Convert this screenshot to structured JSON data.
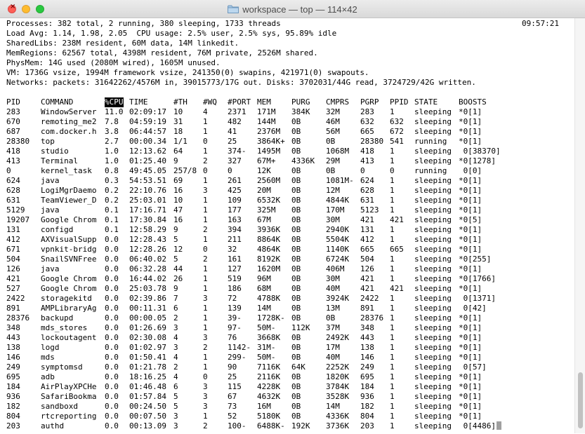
{
  "window": {
    "title": "workspace — top — 114×42",
    "icon": "folder-icon"
  },
  "summary": {
    "processes": "Processes: 382 total, 2 running, 380 sleeping, 1733 threads",
    "clock": "09:57:21",
    "load": "Load Avg: 1.14, 1.98, 2.05  CPU usage: 2.5% user, 2.5% sys, 95.89% idle",
    "sharedlibs": "SharedLibs: 238M resident, 60M data, 14M linkedit.",
    "memregions": "MemRegions: 62567 total, 4398M resident, 76M private, 2526M shared.",
    "physmem": "PhysMem: 14G used (2080M wired), 1605M unused.",
    "vm": "VM: 1736G vsize, 1994M framework vsize, 241350(0) swapins, 421971(0) swapouts.",
    "networks": "Networks: packets: 31642262/4576M in, 39015773/17G out. Disks: 3702031/44G read, 3724729/42G written."
  },
  "table": {
    "headers": [
      "PID",
      "COMMAND",
      "%CPU",
      "TIME",
      "#TH",
      "#WQ",
      "#PORT",
      "MEM",
      "PURG",
      "CMPRS",
      "PGRP",
      "PPID",
      "STATE",
      "BOOSTS"
    ],
    "sorted_column": "%CPU",
    "rows": [
      [
        "283",
        "WindowServer",
        "11.0",
        "02:09:17",
        "10",
        "4",
        "2371",
        "171M",
        "384K",
        "32M",
        "283",
        "1",
        "sleeping",
        "*0[1]"
      ],
      [
        "670",
        "remoting_me2",
        "7.8",
        "04:59:19",
        "31",
        "1",
        "482",
        "144M",
        "0B",
        "46M",
        "632",
        "632",
        "sleeping",
        "*0[1]"
      ],
      [
        "687",
        "com.docker.h",
        "3.8",
        "06:44:57",
        "18",
        "1",
        "41",
        "2376M",
        "0B",
        "56M",
        "665",
        "672",
        "sleeping",
        "*0[1]"
      ],
      [
        "28380",
        "top",
        "2.7",
        "00:00.34",
        "1/1",
        "0",
        "25",
        "3864K+",
        "0B",
        "0B",
        "28380",
        "541",
        "running",
        "*0[1]"
      ],
      [
        "418",
        "studio",
        "1.0",
        "12:13.62",
        "64",
        "1",
        "374-",
        "1495M",
        "0B",
        "1068M",
        "418",
        "1",
        "sleeping",
        " 0[38370]"
      ],
      [
        "413",
        "Terminal",
        "1.0",
        "01:25.40",
        "9",
        "2",
        "327",
        "67M+",
        "4336K",
        "29M",
        "413",
        "1",
        "sleeping",
        "*0[1278]"
      ],
      [
        "0",
        "kernel_task",
        "0.8",
        "49:45.05",
        "257/8",
        "0",
        "0",
        "12K",
        "0B",
        "0B",
        "0",
        "0",
        "running",
        " 0[0]"
      ],
      [
        "624",
        "java",
        "0.3",
        "54:53.51",
        "69",
        "1",
        "261",
        "2560M",
        "0B",
        "1081M-",
        "624",
        "1",
        "sleeping",
        "*0[1]"
      ],
      [
        "628",
        "LogiMgrDaemo",
        "0.2",
        "22:10.76",
        "16",
        "3",
        "425",
        "20M",
        "0B",
        "12M",
        "628",
        "1",
        "sleeping",
        "*0[1]"
      ],
      [
        "631",
        "TeamViewer_D",
        "0.2",
        "25:03.01",
        "10",
        "1",
        "109",
        "6532K",
        "0B",
        "4844K",
        "631",
        "1",
        "sleeping",
        "*0[1]"
      ],
      [
        "5129",
        "java",
        "0.1",
        "17:16.71",
        "47",
        "1",
        "177",
        "325M",
        "0B",
        "170M",
        "5123",
        "1",
        "sleeping",
        "*0[1]"
      ],
      [
        "19207",
        "Google Chrom",
        "0.1",
        "17:30.84",
        "16",
        "1",
        "163",
        "67M",
        "0B",
        "30M",
        "421",
        "421",
        "sleeping",
        "*0[5]"
      ],
      [
        "131",
        "configd",
        "0.1",
        "12:58.29",
        "9",
        "2",
        "394",
        "3936K",
        "0B",
        "2940K",
        "131",
        "1",
        "sleeping",
        "*0[1]"
      ],
      [
        "412",
        "AXVisualSupp",
        "0.0",
        "12:28.43",
        "5",
        "1",
        "211",
        "8864K",
        "0B",
        "5504K",
        "412",
        "1",
        "sleeping",
        "*0[1]"
      ],
      [
        "671",
        "vpnkit-bridg",
        "0.0",
        "12:28.26",
        "12",
        "0",
        "32",
        "4864K",
        "0B",
        "1140K",
        "665",
        "665",
        "sleeping",
        "*0[1]"
      ],
      [
        "504",
        "SnailSVNFree",
        "0.0",
        "06:40.02",
        "5",
        "2",
        "161",
        "8192K",
        "0B",
        "6724K",
        "504",
        "1",
        "sleeping",
        "*0[255]"
      ],
      [
        "126",
        "java",
        "0.0",
        "06:32.28",
        "44",
        "1",
        "127",
        "1620M",
        "0B",
        "406M",
        "126",
        "1",
        "sleeping",
        "*0[1]"
      ],
      [
        "421",
        "Google Chrom",
        "0.0",
        "16:44.02",
        "26",
        "1",
        "519",
        "96M",
        "0B",
        "30M",
        "421",
        "1",
        "sleeping",
        "*0[1766]"
      ],
      [
        "527",
        "Google Chrom",
        "0.0",
        "25:03.78",
        "9",
        "1",
        "186",
        "68M",
        "0B",
        "40M",
        "421",
        "421",
        "sleeping",
        "*0[1]"
      ],
      [
        "2422",
        "storagekitd",
        "0.0",
        "02:39.86",
        "7",
        "3",
        "72",
        "4788K",
        "0B",
        "3924K",
        "2422",
        "1",
        "sleeping",
        " 0[1371]"
      ],
      [
        "891",
        "AMPLibraryAg",
        "0.0",
        "00:11.31",
        "6",
        "1",
        "139",
        "14M",
        "0B",
        "13M",
        "891",
        "1",
        "sleeping",
        " 0[42]"
      ],
      [
        "28376",
        "backupd",
        "0.0",
        "00:00.05",
        "2",
        "1",
        "39-",
        "1728K-",
        "0B",
        "0B",
        "28376",
        "1",
        "sleeping",
        "*0[1]"
      ],
      [
        "348",
        "mds_stores",
        "0.0",
        "01:26.69",
        "3",
        "1",
        "97-",
        "50M-",
        "112K",
        "37M",
        "348",
        "1",
        "sleeping",
        "*0[1]"
      ],
      [
        "443",
        "lockoutagent",
        "0.0",
        "02:30.08",
        "4",
        "3",
        "76",
        "3668K",
        "0B",
        "2492K",
        "443",
        "1",
        "sleeping",
        "*0[1]"
      ],
      [
        "138",
        "logd",
        "0.0",
        "01:02.97",
        "3",
        "2",
        "1142-",
        "31M-",
        "0B",
        "17M",
        "138",
        "1",
        "sleeping",
        "*0[1]"
      ],
      [
        "146",
        "mds",
        "0.0",
        "01:50.41",
        "4",
        "1",
        "299-",
        "50M-",
        "0B",
        "40M",
        "146",
        "1",
        "sleeping",
        "*0[1]"
      ],
      [
        "249",
        "symptomsd",
        "0.0",
        "01:21.78",
        "2",
        "1",
        "90",
        "7116K",
        "64K",
        "2252K",
        "249",
        "1",
        "sleeping",
        " 0[57]"
      ],
      [
        "695",
        "adb",
        "0.0",
        "18:16.25",
        "4",
        "0",
        "25",
        "2116K",
        "0B",
        "1820K",
        "695",
        "1",
        "sleeping",
        "*0[1]"
      ],
      [
        "184",
        "AirPlayXPCHe",
        "0.0",
        "01:46.48",
        "6",
        "3",
        "115",
        "4228K",
        "0B",
        "3784K",
        "184",
        "1",
        "sleeping",
        "*0[1]"
      ],
      [
        "936",
        "SafariBookma",
        "0.0",
        "01:57.84",
        "5",
        "3",
        "67",
        "4632K",
        "0B",
        "3528K",
        "936",
        "1",
        "sleeping",
        "*0[1]"
      ],
      [
        "182",
        "sandboxd",
        "0.0",
        "00:24.50",
        "5",
        "3",
        "73",
        "16M",
        "0B",
        "14M",
        "182",
        "1",
        "sleeping",
        "*0[1]"
      ],
      [
        "804",
        "rtcreporting",
        "0.0",
        "00:07.50",
        "3",
        "1",
        "52",
        "5180K",
        "0B",
        "4336K",
        "804",
        "1",
        "sleeping",
        "*0[1]"
      ],
      [
        "203",
        "authd",
        "0.0",
        "00:13.09",
        "3",
        "2",
        "100-",
        "6488K-",
        "192K",
        "3736K",
        "203",
        "1",
        "sleeping",
        " 0[4486]"
      ]
    ]
  }
}
